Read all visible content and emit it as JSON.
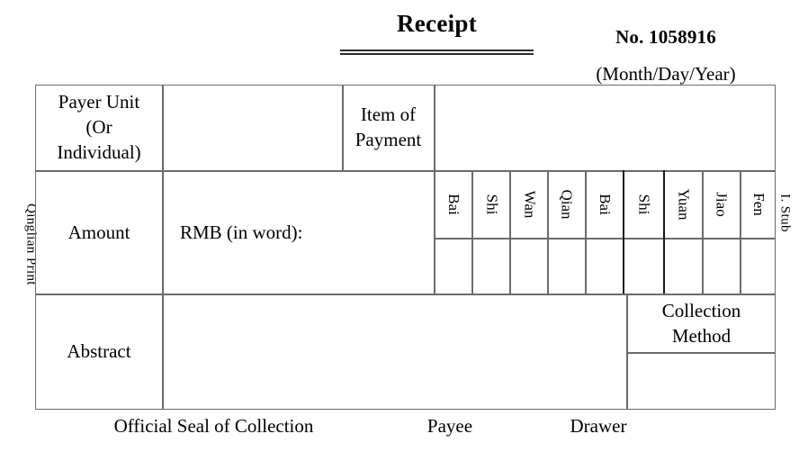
{
  "header": {
    "title": "Receipt",
    "receipt_number": "No. 1058916",
    "date_format": "(Month/Day/Year)"
  },
  "side_labels": {
    "left": "Qinglian Print",
    "right": "I. Stub"
  },
  "rows": {
    "payer": {
      "label_line1": "Payer Unit",
      "label_line2": "(Or",
      "label_line3": "Individual)",
      "value": "",
      "item_label_line1": "Item of",
      "item_label_line2": "Payment",
      "item_value": ""
    },
    "amount": {
      "label": "Amount",
      "rmb_label": "RMB (in word):"
    },
    "abstract": {
      "label": "Abstract",
      "value": "",
      "collection_line1": "Collection",
      "collection_line2": "Method",
      "collection_value": ""
    }
  },
  "currency_columns": [
    {
      "unit": "Bai",
      "value": ""
    },
    {
      "unit": "Shi",
      "value": ""
    },
    {
      "unit": "Wan",
      "value": ""
    },
    {
      "unit": "Qian",
      "value": ""
    },
    {
      "unit": "Bai",
      "value": ""
    },
    {
      "unit": "Shi",
      "value": ""
    },
    {
      "unit": "Yuan",
      "value": ""
    },
    {
      "unit": "Jiao",
      "value": ""
    },
    {
      "unit": "Fen",
      "value": ""
    }
  ],
  "footer": {
    "seal": "Official Seal of Collection",
    "payee": "Payee",
    "drawer": "Drawer"
  },
  "colors": {
    "ink": "#000000",
    "rule": "#6b6b6b",
    "rule_dark": "#1a1a1a",
    "paper": "#ffffff"
  }
}
